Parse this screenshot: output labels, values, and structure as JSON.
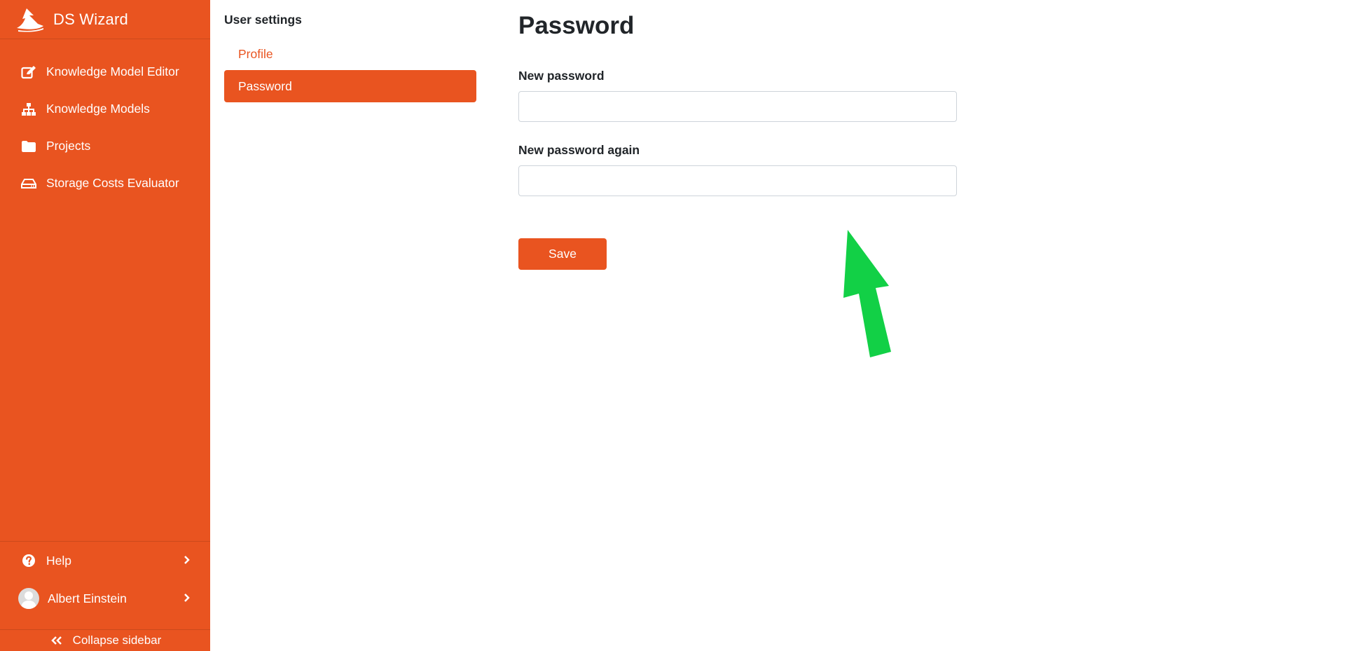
{
  "app": {
    "name": "DS Wizard",
    "accent_color": "#E95420"
  },
  "sidebar": {
    "items": [
      {
        "label": "Knowledge Model Editor",
        "icon": "edit-icon"
      },
      {
        "label": "Knowledge Models",
        "icon": "sitemap-icon"
      },
      {
        "label": "Projects",
        "icon": "folder-icon"
      },
      {
        "label": "Storage Costs Evaluator",
        "icon": "hard-drive-icon"
      }
    ],
    "bottom": {
      "help_label": "Help",
      "user_name": "Albert Einstein",
      "collapse_label": "Collapse sidebar"
    }
  },
  "settings_nav": {
    "title": "User settings",
    "items": [
      {
        "label": "Profile",
        "active": false
      },
      {
        "label": "Password",
        "active": true
      }
    ]
  },
  "form": {
    "title": "Password",
    "new_password_label": "New password",
    "new_password_value": "",
    "new_password_again_label": "New password again",
    "new_password_again_value": "",
    "save_label": "Save"
  },
  "annotation": {
    "arrow_color": "#12D046",
    "icon": "green-arrow-annotation"
  }
}
